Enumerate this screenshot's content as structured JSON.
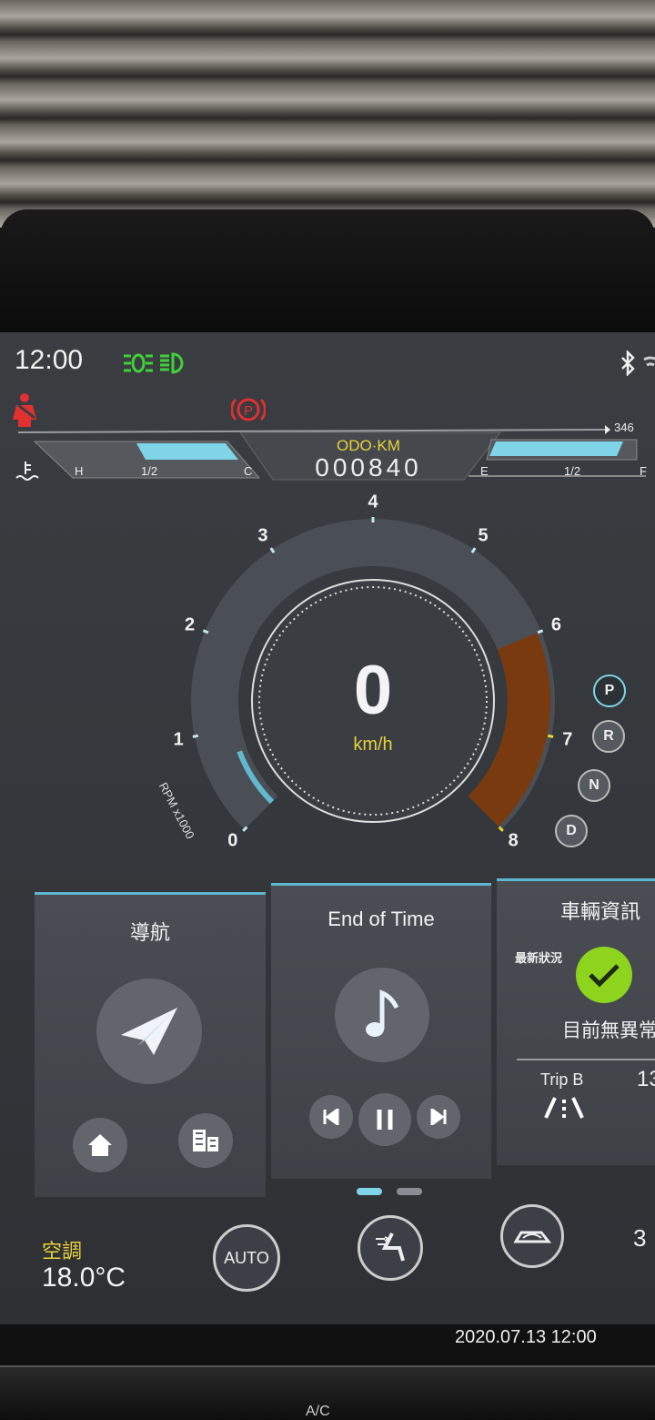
{
  "status": {
    "time": "12:00",
    "range": "346"
  },
  "gauges": {
    "temp_h": "H",
    "temp_half": "1/2",
    "temp_c": "C",
    "fuel_e": "E",
    "fuel_half": "1/2",
    "fuel_f": "F",
    "temp_level": 0.45,
    "fuel_level": 0.6
  },
  "odo": {
    "label": "ODO·KM",
    "value": "000840"
  },
  "tach": {
    "ticks": [
      "0",
      "1",
      "2",
      "3",
      "4",
      "5",
      "6",
      "7",
      "8"
    ],
    "label": "RPM x1000",
    "rpm": 0.5,
    "redline_start": 6
  },
  "speed": {
    "value": "0",
    "unit": "km/h"
  },
  "gears": [
    "P",
    "R",
    "N",
    "D"
  ],
  "gear_selected": "P",
  "cards": {
    "nav": {
      "title": "導航"
    },
    "music": {
      "title": "End of Time"
    },
    "vehicle": {
      "title": "車輛資訊",
      "status_label": "最新狀況",
      "status_text": "目前無異常",
      "trip": "Trip B",
      "trip_value": "13"
    }
  },
  "climate": {
    "label": "空調",
    "temp": "18.0°C",
    "auto": "AUTO",
    "extra": "3"
  },
  "photo_timestamp": "2020.07.13 12:00",
  "bottom_buttons": [
    "A/C"
  ],
  "colors": {
    "accent": "#5fb7d0",
    "redline": "#7a3a10",
    "warning": "#e03030",
    "ok": "#8ed41e",
    "lights": "#3fd13a",
    "odo": "#e8d23a"
  }
}
